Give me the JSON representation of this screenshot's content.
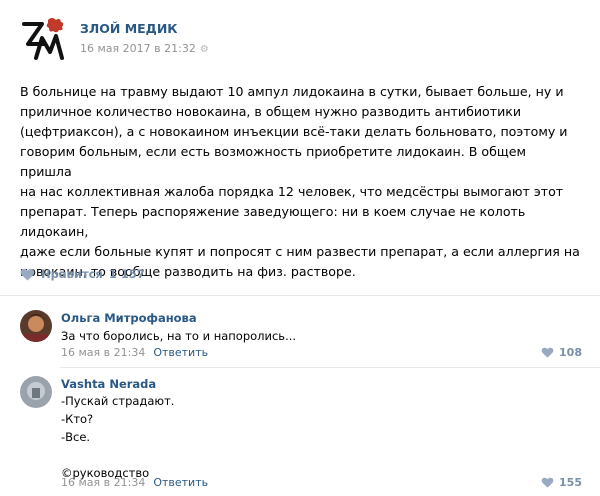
{
  "post": {
    "group_name": "ЗЛОЙ МЕДИК",
    "date": "16 мая 2017 в 21:32",
    "text": "В больнице на травму выдают 10 ампул лидокаина в сутки, бывает больше, ну и\nприличное количество новокаина, в общем нужно разводить антибиотики\n(цефтриаксон), а с новокаином инъекции всё-таки делать больновато, поэтому и\nговорим больным, если есть возможность приобретите лидокаин. В общем пришла\nна нас коллективная жалоба порядка 12 человек, что медсёстры вымогают этот\nпрепарат. Теперь распоряжение заведующего: ни в коем случае не колоть лидокаин,\nдаже если больные купят и попросят с ним развести препарат, а если аллергия на\nновокаин, то вообще разводить на физ. растворе.",
    "like_label": "Нравится",
    "like_count": "1 157"
  },
  "comments": [
    {
      "author": "Ольга Митрофанова",
      "text": "За что боролись, на то и напоролись...",
      "date": "16 мая в 21:34",
      "reply_label": "Ответить",
      "likes": "108"
    },
    {
      "author": "Vashta Nerada",
      "text": "-Пускай страдают.\n-Кто?\n-Все.\n\n©руководство",
      "date": "16 мая в 21:34",
      "reply_label": "Ответить",
      "likes": "155"
    }
  ],
  "colors": {
    "link": "#2a5885",
    "meta": "#939393",
    "like": "#7a8fa8",
    "logo_red": "#c0392b"
  }
}
